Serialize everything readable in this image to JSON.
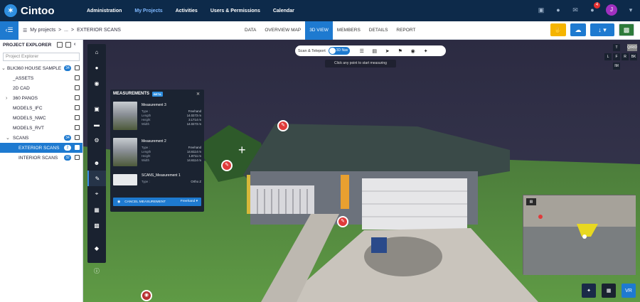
{
  "app": {
    "logo_text": "Cintoo"
  },
  "nav": [
    "Administration",
    "My Projects",
    "Activities",
    "Users & Permissions",
    "Calendar"
  ],
  "notifications_count": "4",
  "user_initial": "J",
  "breadcrumb": {
    "root": "My projects",
    "ellipsis": "...",
    "current": "EXTERIOR SCANS"
  },
  "tabs": [
    "DATA",
    "OVERVIEW MAP",
    "3D VIEW",
    "MEMBERS",
    "DETAILS",
    "REPORT"
  ],
  "sidebar": {
    "title": "PROJECT EXPLORER",
    "search_placeholder": "Project Explorer",
    "items": [
      {
        "label": "BLK360 HOUSE SAMPLE",
        "count": "34"
      },
      {
        "label": "_ASSETS"
      },
      {
        "label": "2D CAD"
      },
      {
        "label": "360 PANOS"
      },
      {
        "label": "MODELS_IFC"
      },
      {
        "label": "MODELS_NWC"
      },
      {
        "label": "MODELS_RVT"
      },
      {
        "label": "SCANS",
        "count": "34"
      },
      {
        "label": "EXTERIOR SCANS",
        "count": "2"
      },
      {
        "label": "INTERIOR SCANS",
        "count": "32"
      }
    ]
  },
  "viewbar": {
    "mode": "Scan & Teleport",
    "toggle": "3D Nav"
  },
  "hint": "Click any point to start measuring",
  "cube": [
    "T",
    "L",
    "F",
    "R",
    "BK",
    "IM"
  ],
  "cube_label": "Q/R/D",
  "measurements": {
    "title": "MEASUREMENTS",
    "beta": "BETA",
    "items": [
      {
        "name": "Measurement 3",
        "rows": [
          {
            "k": "Type :",
            "v": "Freehand"
          },
          {
            "k": "Length",
            "v": "14.0273 m"
          },
          {
            "k": "Height",
            "v": "3.1714 m"
          },
          {
            "k": "Width",
            "v": "14.0273 m"
          }
        ]
      },
      {
        "name": "Measurement 2",
        "rows": [
          {
            "k": "Type :",
            "v": "Freehand"
          },
          {
            "k": "Length",
            "v": "14.6114 m"
          },
          {
            "k": "Height",
            "v": "1.8711 m"
          },
          {
            "k": "Width",
            "v": "14.6114 m"
          }
        ]
      },
      {
        "name": "SCANS_Measurement 1",
        "rows": [
          {
            "k": "Type :",
            "v": "Ortho Z"
          }
        ]
      }
    ],
    "cancel_label": "CANCEL MEASUREMENT",
    "mode": "Freehand"
  },
  "colors": {
    "topbar": "#0d2a4a",
    "accent": "#1e7ad0",
    "yellow_button": "#f5b400",
    "pin": "#e03a3a"
  }
}
